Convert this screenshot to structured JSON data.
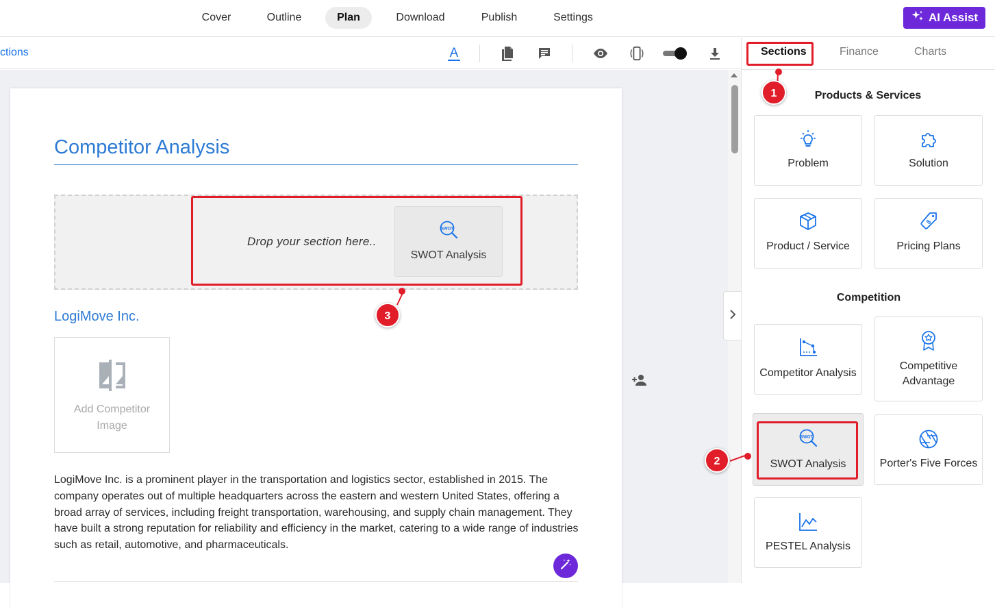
{
  "topnav": {
    "tabs": [
      {
        "label": "Cover"
      },
      {
        "label": "Outline"
      },
      {
        "label": "Plan"
      },
      {
        "label": "Download"
      },
      {
        "label": "Publish"
      },
      {
        "label": "Settings"
      }
    ],
    "active": "Plan",
    "ai_assist_label": "AI Assist"
  },
  "toolbar": {
    "breadcrumb": "ctions",
    "tools": [
      "text-format-icon",
      "document-icon",
      "comment-icon",
      "eye-icon",
      "mobile-preview-icon",
      "toggle-switch",
      "download-icon"
    ]
  },
  "document": {
    "title": "Competitor Analysis",
    "dropzone": {
      "prompt": "Drop your section here..",
      "dragged_card_label": "SWOT Analysis"
    },
    "competitor_name": "LogiMove Inc.",
    "image_placeholder": "Add Competitor Image",
    "description": "LogiMove Inc. is a prominent player in the transportation and logistics sector, established in 2015. The company operates out of multiple headquarters across the eastern and western United States, offering a broad array of services, including freight transportation, warehousing, and supply chain management. They have built a strong reputation for reliability and efficiency in the market, catering to a wide range of industries such as retail, automotive, and pharmaceuticals."
  },
  "panel": {
    "tabs": [
      {
        "label": "Sections"
      },
      {
        "label": "Finance"
      },
      {
        "label": "Charts"
      }
    ],
    "active_tab": "Sections",
    "groups": [
      {
        "heading": "Products & Services",
        "cards": [
          {
            "label": "Problem",
            "icon": "lightbulb-icon"
          },
          {
            "label": "Solution",
            "icon": "puzzle-icon"
          },
          {
            "label": "Product / Service",
            "icon": "cube-icon"
          },
          {
            "label": "Pricing Plans",
            "icon": "price-tag-icon"
          }
        ]
      },
      {
        "heading": "Competition",
        "cards": [
          {
            "label": "Competitor Analysis",
            "icon": "scatter-chart-icon"
          },
          {
            "label": "Competitive Advantage",
            "icon": "award-badge-icon"
          },
          {
            "label": "SWOT Analysis",
            "icon": "swot-magnifier-icon"
          },
          {
            "label": "Porter's Five Forces",
            "icon": "aperture-icon"
          },
          {
            "label": "PESTEL Analysis",
            "icon": "line-chart-icon"
          }
        ]
      }
    ]
  },
  "annotations": {
    "callouts": [
      "1",
      "2",
      "3"
    ],
    "color": "#e11d2a"
  },
  "colors": {
    "accent_blue": "#2d7bd4",
    "brand_purple": "#6d28d9",
    "icon_blue": "#1a73e8"
  }
}
